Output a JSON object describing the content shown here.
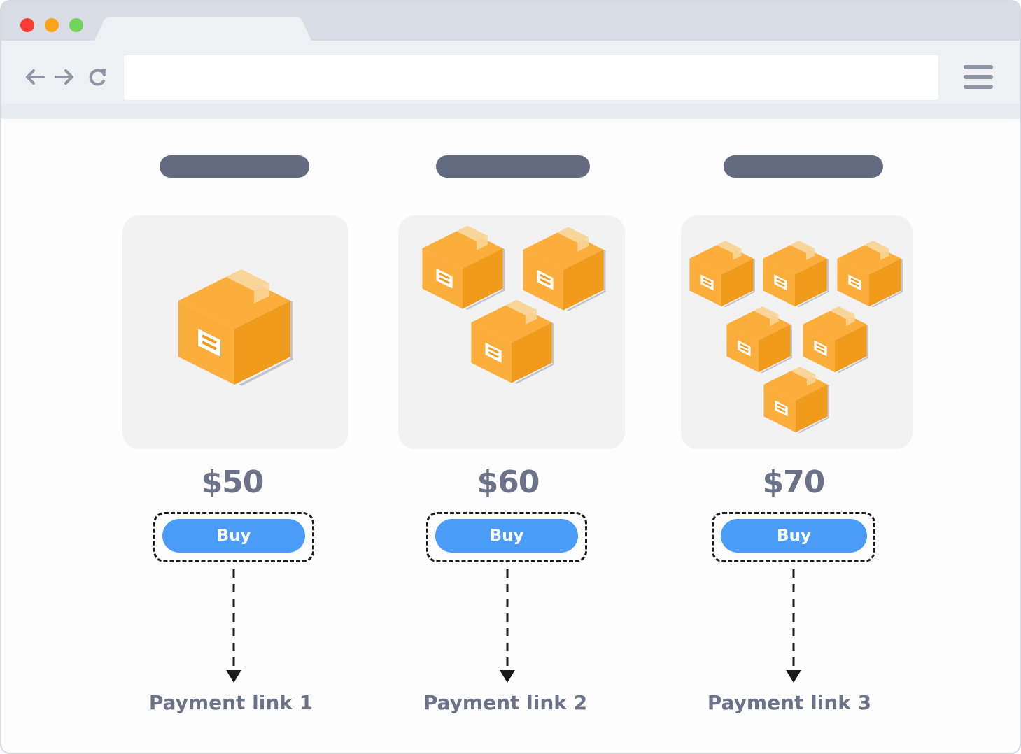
{
  "browser": {
    "window_controls": [
      "close",
      "minimize",
      "maximize"
    ],
    "nav_icons": [
      "back-arrow-icon",
      "forward-arrow-icon",
      "reload-icon"
    ],
    "address_bar_value": "",
    "menu_icon": "hamburger-menu-icon"
  },
  "colors": {
    "box_main": "#fcae3c",
    "box_side": "#f09b1c",
    "button": "#4a9cf7",
    "text": "#6c7389",
    "pill": "#636b80"
  },
  "products": [
    {
      "title": "",
      "box_count": 1,
      "price": "$50",
      "button_label": "Buy",
      "payment_label": "Payment link 1"
    },
    {
      "title": "",
      "box_count": 3,
      "price": "$60",
      "button_label": "Buy",
      "payment_label": "Payment link 2"
    },
    {
      "title": "",
      "box_count": 6,
      "price": "$70",
      "button_label": "Buy",
      "payment_label": "Payment link 3"
    }
  ]
}
